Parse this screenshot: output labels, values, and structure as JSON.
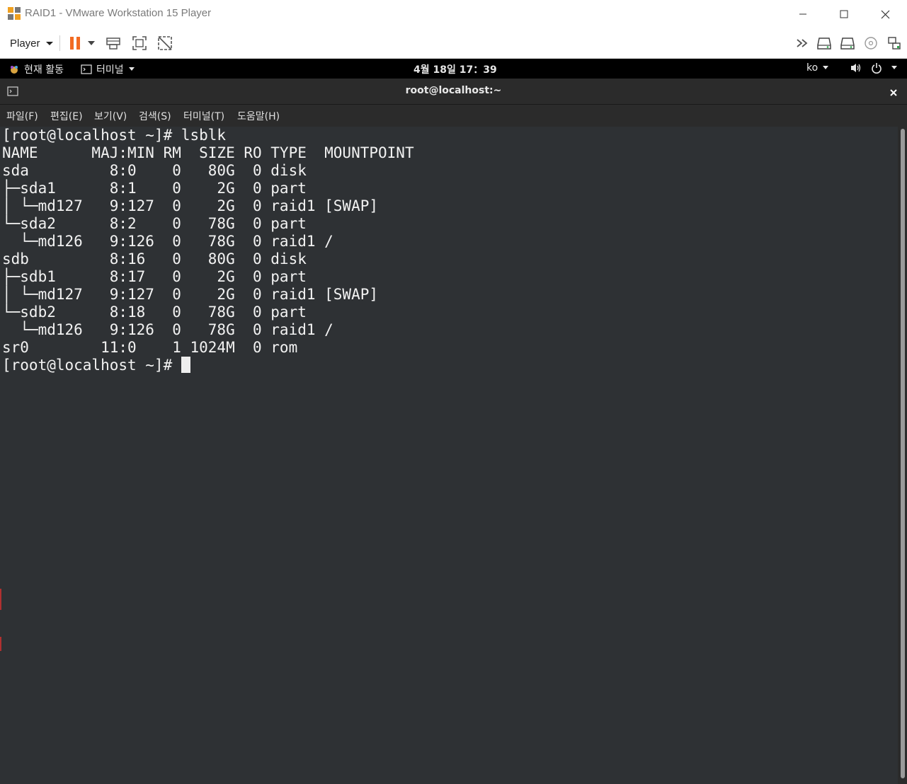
{
  "window": {
    "title": "RAID1 - VMware Workstation 15 Player"
  },
  "toolbar": {
    "player_label": "Player"
  },
  "gnome": {
    "activities": "현재 활동",
    "terminal_app": "터미널",
    "clock": "4월 18일  17：39",
    "lang": "ko"
  },
  "terminal": {
    "title": "root@localhost:~",
    "menu": [
      "파일(F)",
      "편집(E)",
      "보기(V)",
      "검색(S)",
      "터미널(T)",
      "도움말(H)"
    ],
    "lines": [
      "[root@localhost ~]# lsblk",
      "NAME      MAJ:MIN RM  SIZE RO TYPE  MOUNTPOINT",
      "sda         8:0    0   80G  0 disk",
      "├─sda1      8:1    0    2G  0 part",
      "│ └─md127   9:127  0    2G  0 raid1 [SWAP]",
      "└─sda2      8:2    0   78G  0 part",
      "  └─md126   9:126  0   78G  0 raid1 /",
      "sdb         8:16   0   80G  0 disk",
      "├─sdb1      8:17   0    2G  0 part",
      "│ └─md127   9:127  0    2G  0 raid1 [SWAP]",
      "└─sdb2      8:18   0   78G  0 part",
      "  └─md126   9:126  0   78G  0 raid1 /",
      "sr0        11:0    1 1024M  0 rom"
    ],
    "prompt": "[root@localhost ~]# "
  }
}
